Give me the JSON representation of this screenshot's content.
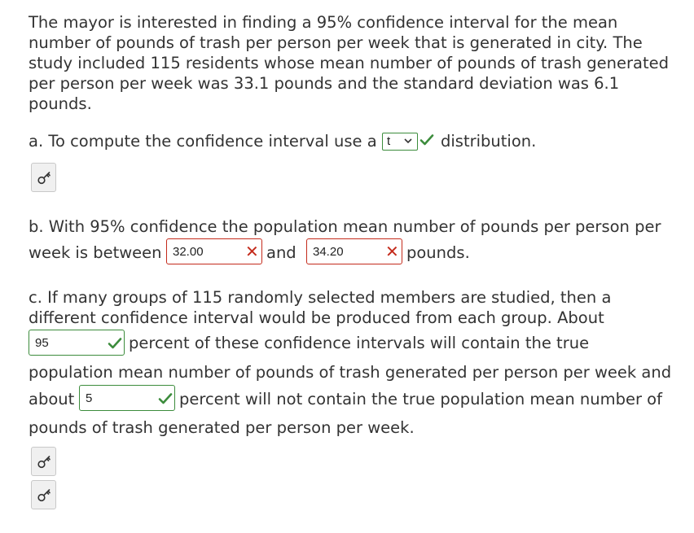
{
  "problem": {
    "line1": "The mayor is interested in finding a 95% confidence interval for the mean",
    "line2": "number of pounds of trash per person per week that is generated in city. The",
    "line3": "study included 115 residents whose mean number of pounds of trash generated",
    "line4": "per person per week was 33.1 pounds and the standard deviation was 6.1",
    "line5": "pounds."
  },
  "part_a": {
    "prefix": "a. To compute the confidence interval use a",
    "selected": "t",
    "suffix": "distribution."
  },
  "part_b": {
    "line1": "b. With 95% confidence the population mean number of pounds per person per",
    "prefix": "week is between",
    "lower_value": "32.00",
    "middle": "and",
    "upper_value": "34.20",
    "suffix": "pounds."
  },
  "part_c": {
    "line1": "c. If many groups of 115 randomly selected members are studied, then a",
    "line2": "different confidence interval would be produced from each group. About",
    "contain_value": "95",
    "after_contain": "percent of these confidence intervals will contain the true",
    "line4": "population mean number of pounds of trash generated per person per week and",
    "about": "about",
    "not_contain_value": "5",
    "after_not_contain": "percent will not contain the true population mean number of",
    "line6": "pounds of trash generated per person per week."
  },
  "icons": {
    "hint": "key-icon",
    "correct": "checkmark-icon",
    "incorrect": "x-mark-icon"
  },
  "colors": {
    "text": "#333333",
    "correct": "#3c8c3c",
    "incorrect": "#c42b1c",
    "button_bg": "#f0f0f0"
  }
}
